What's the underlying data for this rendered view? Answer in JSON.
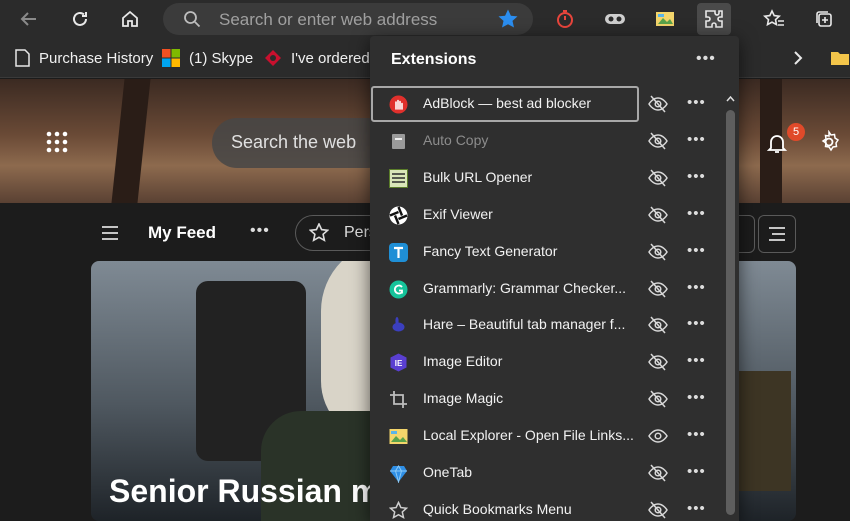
{
  "toolbar": {
    "address_placeholder": "Search or enter web address",
    "accent": "#2b8ef0"
  },
  "bookmarks": {
    "items": [
      {
        "label": "Purchase History",
        "icon": "document-icon"
      },
      {
        "label": "(1) Skype",
        "icon": "windows-logo-icon"
      },
      {
        "label": "I've ordered ...",
        "icon": "red-logo-icon"
      }
    ]
  },
  "page": {
    "web_search_placeholder": "Search the web",
    "notification_count": "5",
    "feed_title": "My Feed",
    "personalize_label": "Pers",
    "headline": "Senior Russian mi"
  },
  "extensions": {
    "title": "Extensions",
    "items": [
      {
        "name": "AdBlock — best ad blocker",
        "icon": "adblock-hand-icon",
        "visible": "hidden",
        "enabled": true,
        "focused": true
      },
      {
        "name": "Auto Copy",
        "icon": "auto-copy-icon",
        "visible": "hidden",
        "enabled": false
      },
      {
        "name": "Bulk URL Opener",
        "icon": "bulk-url-opener-icon",
        "visible": "hidden",
        "enabled": true
      },
      {
        "name": "Exif Viewer",
        "icon": "aperture-icon",
        "visible": "hidden",
        "enabled": true
      },
      {
        "name": "Fancy Text Generator",
        "icon": "fancy-text-t-icon",
        "visible": "hidden",
        "enabled": true
      },
      {
        "name": "Grammarly: Grammar Checker...",
        "icon": "grammarly-g-icon",
        "visible": "hidden",
        "enabled": true
      },
      {
        "name": "Hare – Beautiful tab manager f...",
        "icon": "hare-icon",
        "visible": "hidden",
        "enabled": true
      },
      {
        "name": "Image Editor",
        "icon": "ie-badge-icon",
        "visible": "hidden",
        "enabled": true
      },
      {
        "name": "Image Magic",
        "icon": "crop-icon",
        "visible": "hidden",
        "enabled": true
      },
      {
        "name": "Local Explorer - Open File Links...",
        "icon": "folder-image-icon",
        "visible": "shown",
        "enabled": true
      },
      {
        "name": "OneTab",
        "icon": "onetab-diamond-icon",
        "visible": "hidden",
        "enabled": true
      },
      {
        "name": "Quick Bookmarks Menu",
        "icon": "star-outline-icon",
        "visible": "hidden",
        "enabled": true
      }
    ]
  }
}
